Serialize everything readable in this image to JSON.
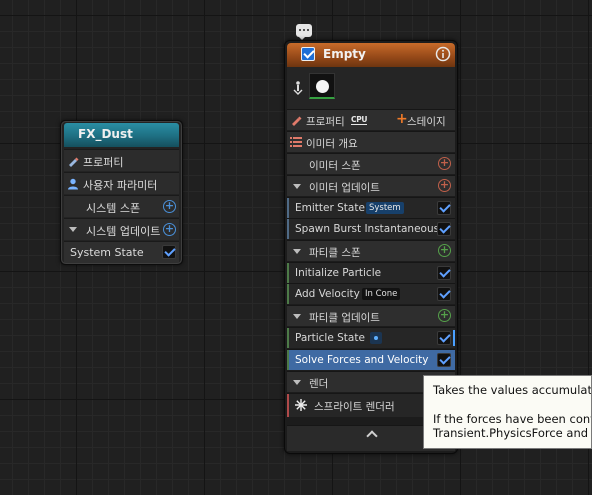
{
  "system_node": {
    "title": "FX_Dust",
    "rows": {
      "properties": "프로퍼티",
      "user_params": "사용자 파라미터",
      "system_spawn": "시스템 스폰",
      "system_update": "시스템 업데이트",
      "system_state": "System State"
    },
    "system_state_enabled": true
  },
  "emitter_node": {
    "comment_icon": "speech-bubble-icon",
    "title": "Empty",
    "enabled": true,
    "properties_label": "프로퍼티",
    "sim_target_label": "CPU",
    "stage_button_label": "스테이지",
    "overview_label": "이미터 개요",
    "emitter_spawn_label": "이미터 스폰",
    "emitter_update_label": "이미터 업데이트",
    "particle_spawn_label": "파티클 스폰",
    "particle_update_label": "파티클 업데이트",
    "render_label": "렌더",
    "modules": {
      "emitter_state": {
        "label": "Emitter State",
        "badge": "System",
        "enabled": true
      },
      "spawn_burst": {
        "label": "Spawn Burst Instantaneous",
        "enabled": true
      },
      "initialize_particle": {
        "label": "Initialize Particle",
        "enabled": true
      },
      "add_velocity": {
        "label": "Add Velocity",
        "badge": "In Cone",
        "enabled": true
      },
      "particle_state": {
        "label": "Particle State",
        "enabled": true
      },
      "solve_forces": {
        "label": "Solve Forces and Velocity",
        "enabled": true,
        "selected": true
      }
    },
    "renderer_label": "스프라이트 렌더러",
    "renderer_enabled": true
  },
  "tooltip": {
    "line1": "Takes the values accumulated",
    "line2": "If the forces have been conver",
    "line3": "Transient.PhysicsForce and T"
  },
  "colors": {
    "system_header": "#1e6f82",
    "emitter_header": "#944818",
    "checkbox": "#1f6fd6",
    "selection": "#3f6aa3"
  }
}
